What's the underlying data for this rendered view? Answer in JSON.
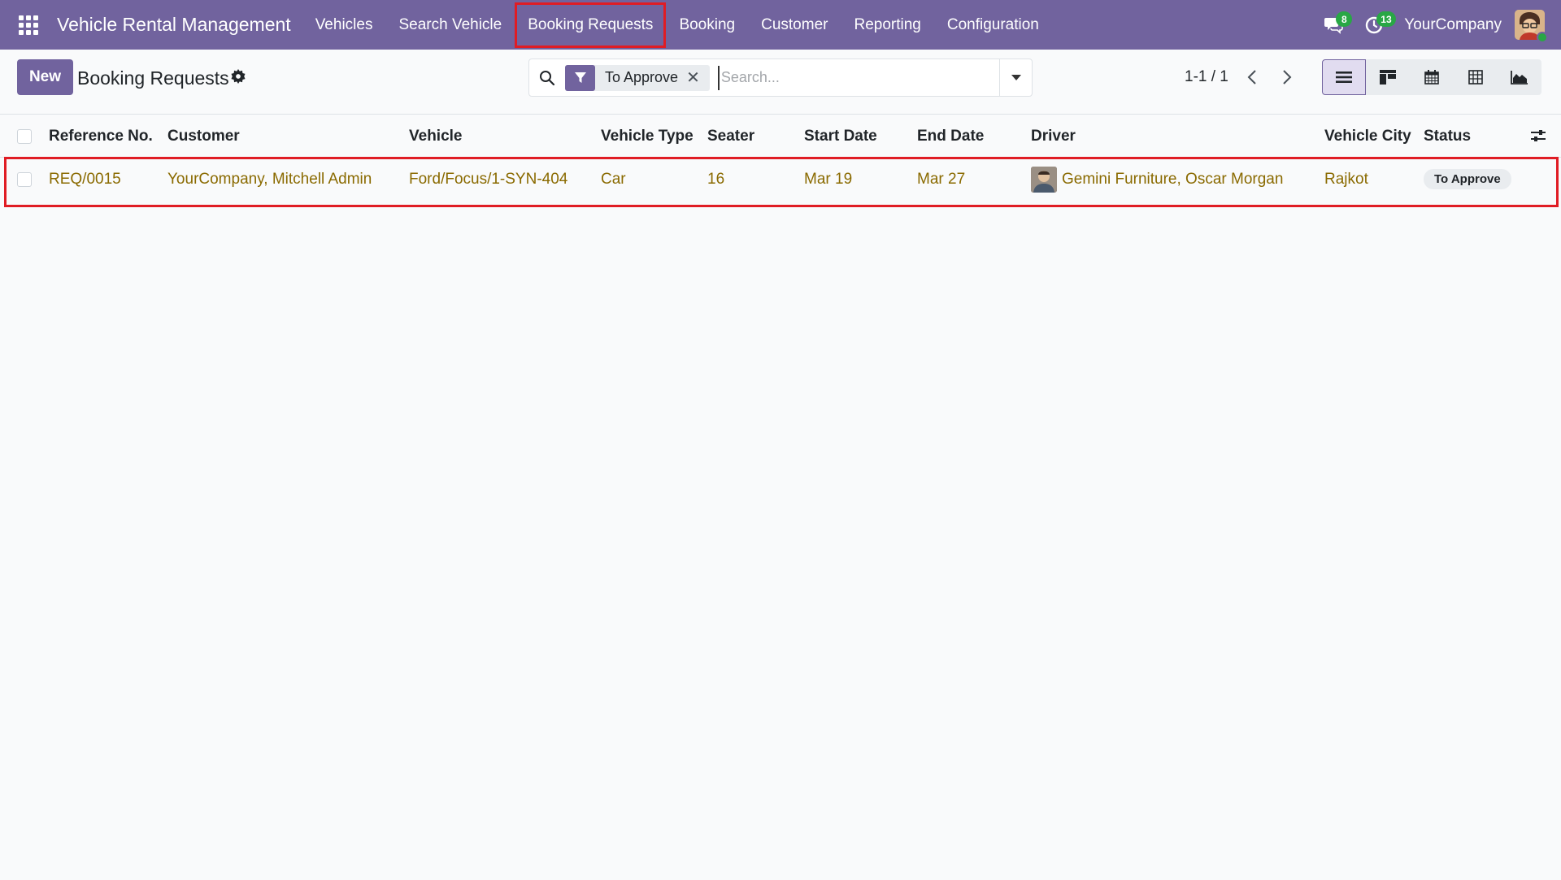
{
  "navbar": {
    "app_name": "Vehicle Rental Management",
    "menu": [
      {
        "label": "Vehicles"
      },
      {
        "label": "Search Vehicle"
      },
      {
        "label": "Booking Requests"
      },
      {
        "label": "Booking"
      },
      {
        "label": "Customer"
      },
      {
        "label": "Reporting"
      },
      {
        "label": "Configuration"
      }
    ],
    "active_menu": "Booking Requests",
    "messages_count": "8",
    "activities_count": "13",
    "company": "YourCompany"
  },
  "control_panel": {
    "new_label": "New",
    "title": "Booking Requests",
    "search": {
      "facet_label": "To Approve",
      "placeholder": "Search..."
    },
    "pager": "1-1 / 1",
    "views": [
      "list-icon",
      "kanban-icon",
      "calendar-icon",
      "pivot-icon",
      "graph-icon"
    ],
    "active_view": "list"
  },
  "list": {
    "columns": [
      "Reference No.",
      "Customer",
      "Vehicle",
      "Vehicle Type",
      "Seater",
      "Start Date",
      "End Date",
      "Driver",
      "Vehicle City",
      "Status"
    ],
    "rows": [
      {
        "reference": "REQ/0015",
        "customer": "YourCompany, Mitchell Admin",
        "vehicle": "Ford/Focus/1-SYN-404",
        "vehicle_type": "Car",
        "seater": "16",
        "start_date": "Mar 19",
        "end_date": "Mar 27",
        "driver": "Gemini Furniture, Oscar Morgan",
        "vehicle_city": "Rajkot",
        "status": "To Approve"
      }
    ]
  },
  "colors": {
    "brand": "#71639e",
    "link": "#8a6a00",
    "highlight": "#e01c24",
    "badge": "#28a745"
  }
}
